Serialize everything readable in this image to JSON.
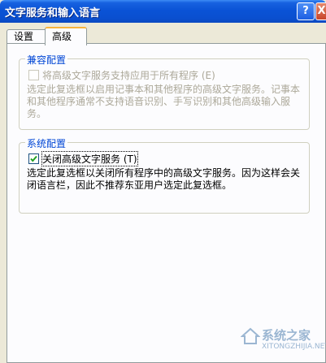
{
  "window": {
    "title": "文字服务和输入语言",
    "help_label": "?",
    "close_label": "X"
  },
  "tabs": [
    {
      "label": "设置"
    },
    {
      "label": "高级"
    }
  ],
  "compat": {
    "group_label": "兼容配置",
    "checkbox_label": "将高级文字服务支持应用于所有程序 (E)",
    "checked": false,
    "enabled": false,
    "desc_line1": "选定此复选框以启用记事本和其他程序的高级文字服务。记事本",
    "desc_line2": "和其他程序通常不支持语音识别、手写识别和其他高级输入服",
    "desc_line3": "务。"
  },
  "system": {
    "group_label": "系统配置",
    "checkbox_label": "关闭高级文字服务 (T)",
    "checked": true,
    "enabled": true,
    "desc_line1": "选定此复选框以关闭所有程序中的高级文字服务。因为这样会关",
    "desc_line2": "闭语言栏，因此不推荐东亚用户选定此复选框。"
  },
  "watermark": {
    "text": "系统之家",
    "url": "XITONGZHIJIA.NET"
  }
}
